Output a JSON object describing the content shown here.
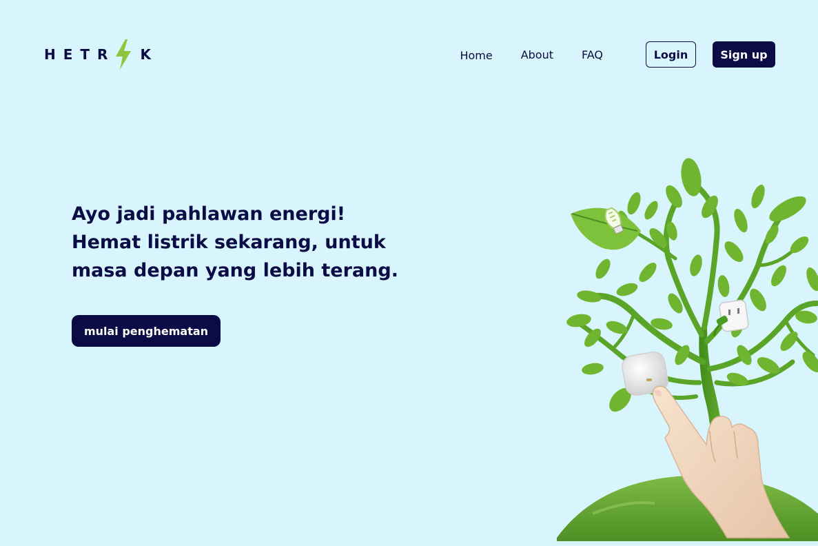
{
  "brand": {
    "left_text": "HETR",
    "right_text": "K",
    "accent_color": "#8cc63f"
  },
  "nav": {
    "links": [
      "Home",
      "About",
      "FAQ"
    ],
    "login_label": "Login",
    "signup_label": "Sign up"
  },
  "hero": {
    "lines": [
      "Ayo jadi pahlawan energi!",
      "Hemat listrik sekarang, untuk",
      "masa depan yang lebih terang."
    ],
    "cta_label": "mulai penghematan"
  },
  "colors": {
    "background": "#d8f4fd",
    "primary": "#0b0b45",
    "leaf": "#6aab2e"
  },
  "illustration": {
    "icons": [
      "tree-icon",
      "lightbulb-icon",
      "power-socket-icon",
      "power-button-icon",
      "pointing-hand-icon",
      "globe-icon"
    ]
  }
}
